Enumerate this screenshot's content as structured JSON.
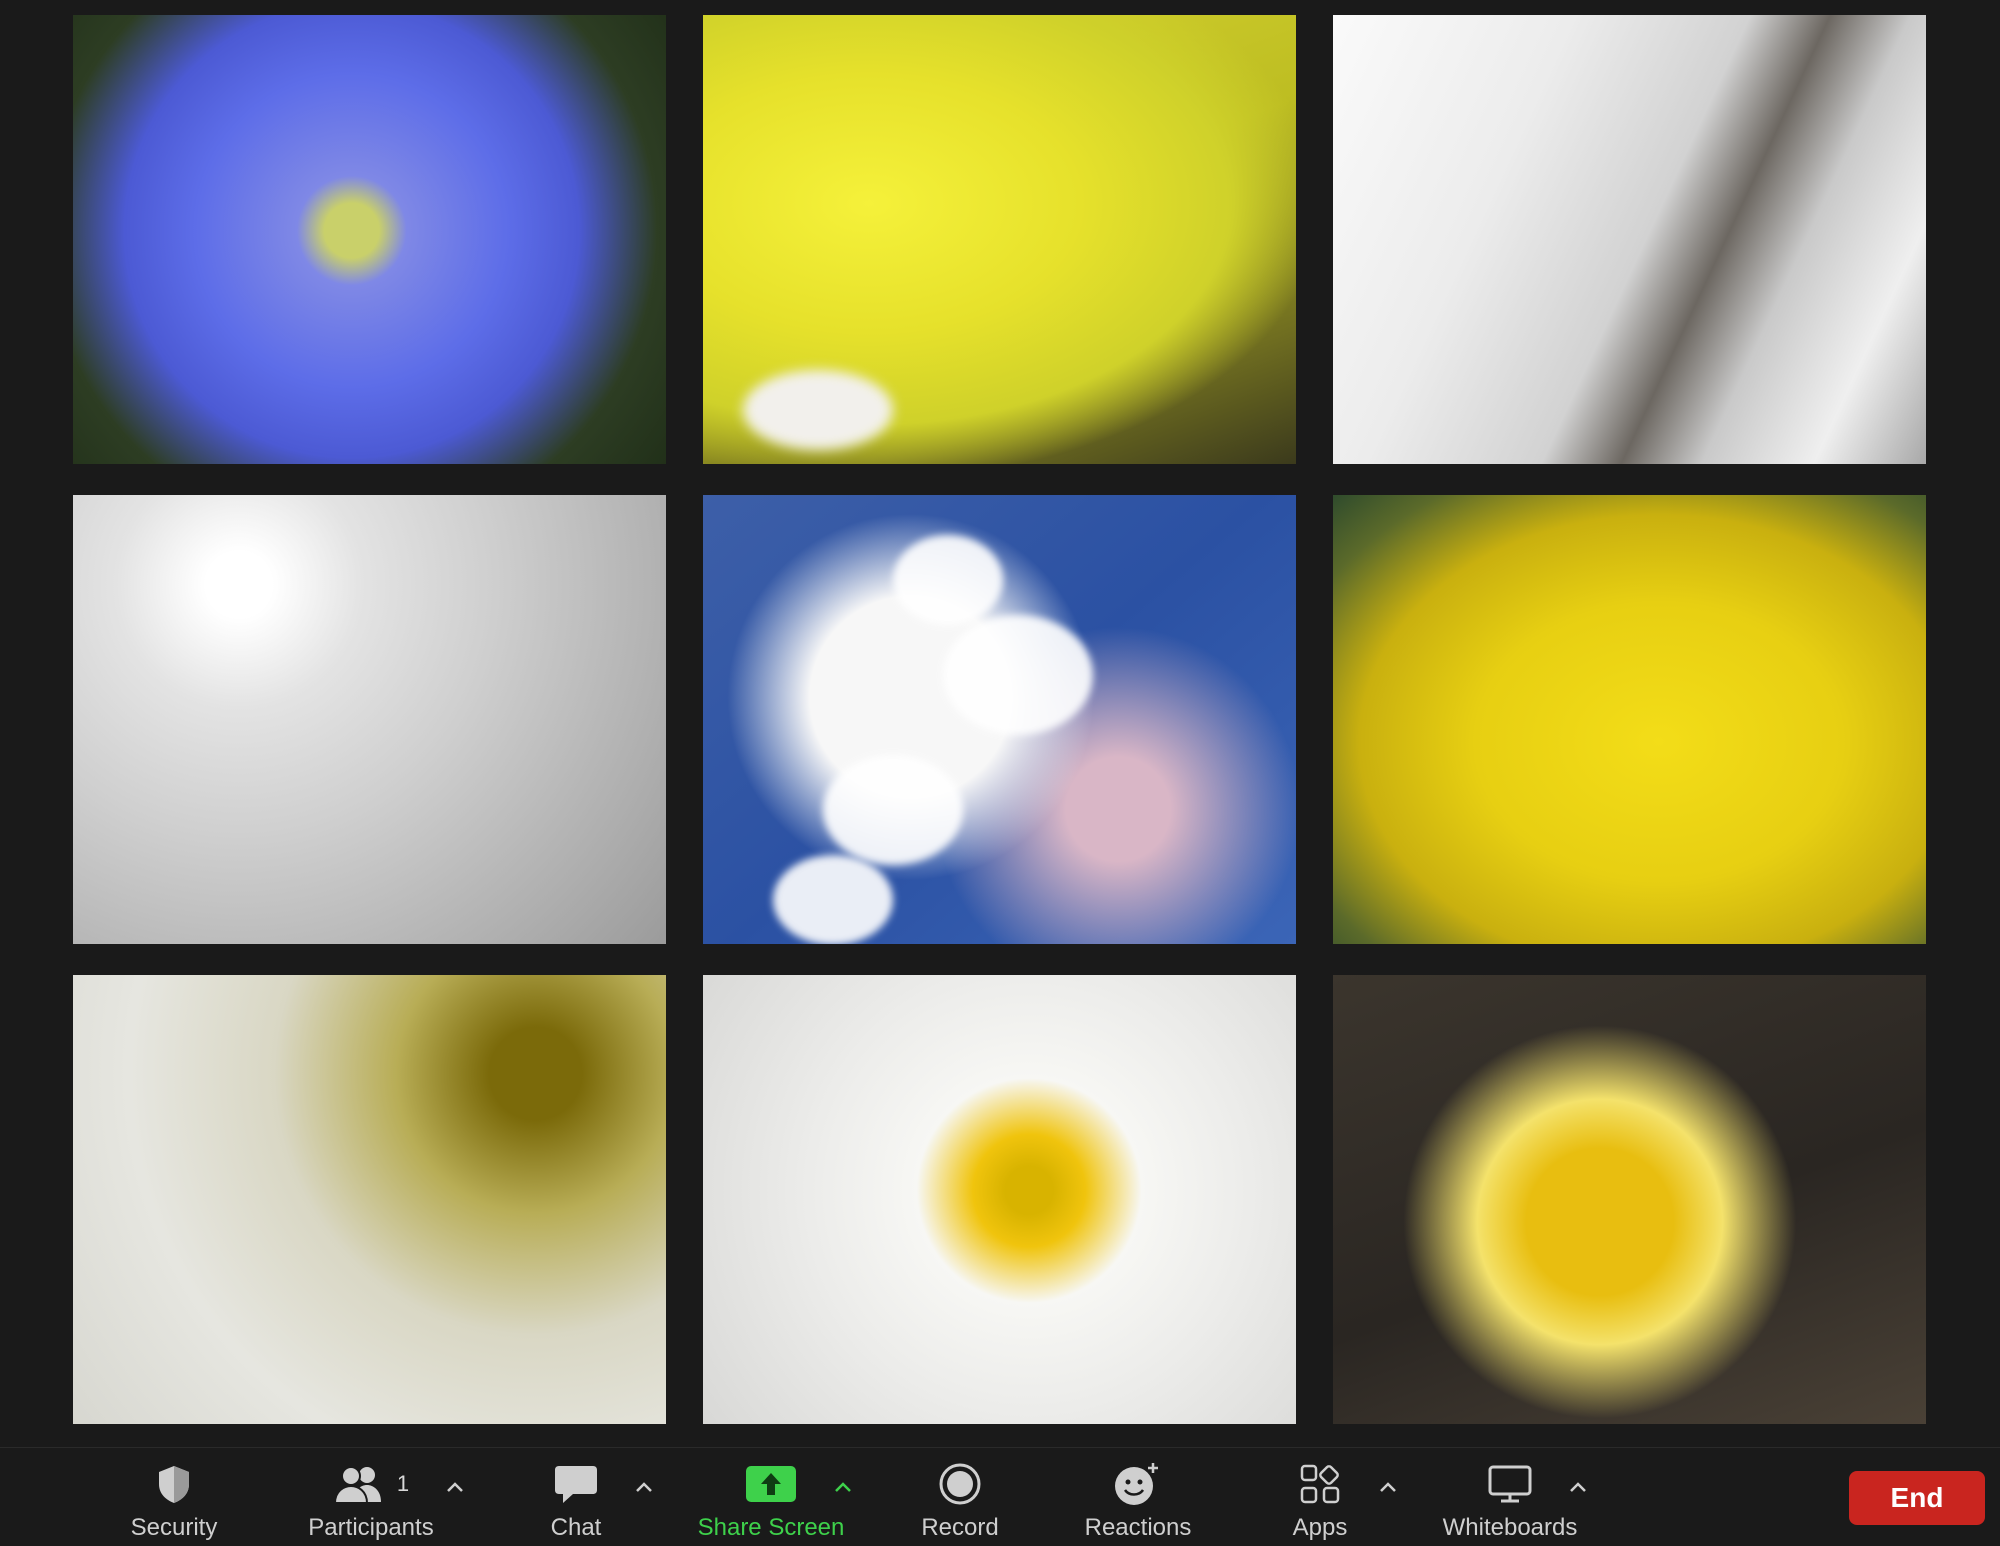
{
  "meeting": {
    "tiles": [
      {
        "name": "tile-1"
      },
      {
        "name": "tile-2"
      },
      {
        "name": "tile-3"
      },
      {
        "name": "tile-4"
      },
      {
        "name": "tile-5"
      },
      {
        "name": "tile-6"
      },
      {
        "name": "tile-7"
      },
      {
        "name": "tile-8"
      },
      {
        "name": "tile-9"
      }
    ]
  },
  "toolbar": {
    "security": {
      "label": "Security",
      "icon": "shield-icon"
    },
    "participants": {
      "label": "Participants",
      "count": "1",
      "icon": "participants-icon"
    },
    "chat": {
      "label": "Chat",
      "icon": "chat-icon"
    },
    "share_screen": {
      "label": "Share Screen",
      "icon": "share-screen-icon",
      "color": "#3ed14b"
    },
    "record": {
      "label": "Record",
      "icon": "record-icon"
    },
    "reactions": {
      "label": "Reactions",
      "icon": "reactions-icon"
    },
    "apps": {
      "label": "Apps",
      "icon": "apps-icon"
    },
    "whiteboards": {
      "label": "Whiteboards",
      "icon": "whiteboard-icon"
    },
    "end": {
      "label": "End",
      "color": "#c9251f"
    }
  }
}
